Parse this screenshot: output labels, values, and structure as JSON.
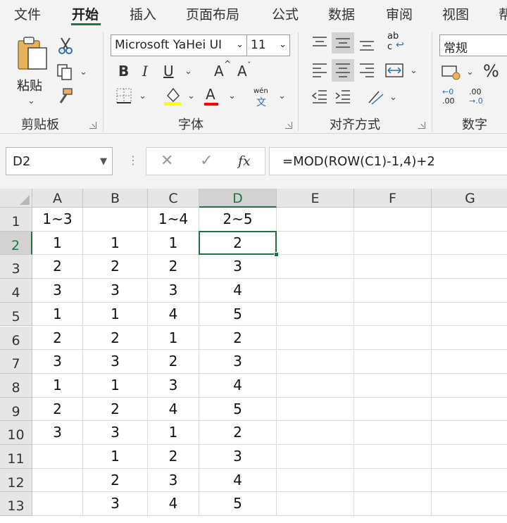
{
  "tabs": [
    "文件",
    "开始",
    "插入",
    "页面布局",
    "公式",
    "数据",
    "审阅",
    "视图",
    "帮"
  ],
  "active_tab": "开始",
  "clipboard": {
    "paste_label": "粘贴",
    "group_label": "剪贴板"
  },
  "font": {
    "name": "Microsoft YaHei UI",
    "size": "11",
    "bold": "B",
    "italic": "I",
    "underline": "U",
    "grow": "A",
    "shrink": "A",
    "color_letter": "A",
    "phonetic_top": "wén",
    "phonetic_bottom": "文",
    "group_label": "字体"
  },
  "alignment": {
    "wrap_top": "ab",
    "wrap_bottom": "c",
    "group_label": "对齐方式"
  },
  "number": {
    "format": "常规",
    "percent": "%",
    "group_label": "数字",
    "inc_top": "←0",
    "inc_bottom": ".00",
    "dec_top": ".00",
    "dec_bottom": "→.0"
  },
  "formula_bar": {
    "name_box": "D2",
    "fx_label": "fx",
    "formula": "=MOD(ROW(C1)-1,4)+2"
  },
  "grid": {
    "columns": [
      "A",
      "B",
      "C",
      "D",
      "E",
      "F",
      "G"
    ],
    "selected_column": "D",
    "selected_row": "2",
    "rows": [
      {
        "num": "1",
        "cells": [
          "1~3",
          "",
          "1~4",
          "2~5",
          "",
          "",
          ""
        ]
      },
      {
        "num": "2",
        "cells": [
          "1",
          "1",
          "1",
          "2",
          "",
          "",
          ""
        ]
      },
      {
        "num": "3",
        "cells": [
          "2",
          "2",
          "2",
          "3",
          "",
          "",
          ""
        ]
      },
      {
        "num": "4",
        "cells": [
          "3",
          "3",
          "3",
          "4",
          "",
          "",
          ""
        ]
      },
      {
        "num": "5",
        "cells": [
          "1",
          "1",
          "4",
          "5",
          "",
          "",
          ""
        ]
      },
      {
        "num": "6",
        "cells": [
          "2",
          "2",
          "1",
          "2",
          "",
          "",
          ""
        ]
      },
      {
        "num": "7",
        "cells": [
          "3",
          "3",
          "2",
          "3",
          "",
          "",
          ""
        ]
      },
      {
        "num": "8",
        "cells": [
          "1",
          "1",
          "3",
          "4",
          "",
          "",
          ""
        ]
      },
      {
        "num": "9",
        "cells": [
          "2",
          "2",
          "4",
          "5",
          "",
          "",
          ""
        ]
      },
      {
        "num": "10",
        "cells": [
          "3",
          "3",
          "1",
          "2",
          "",
          "",
          ""
        ]
      },
      {
        "num": "11",
        "cells": [
          "",
          "1",
          "2",
          "3",
          "",
          "",
          ""
        ]
      },
      {
        "num": "12",
        "cells": [
          "",
          "2",
          "3",
          "4",
          "",
          "",
          ""
        ]
      },
      {
        "num": "13",
        "cells": [
          "",
          "3",
          "4",
          "5",
          "",
          "",
          ""
        ]
      }
    ]
  },
  "colors": {
    "accent": "#217346",
    "ribbon_bg": "#f3f3f3",
    "header_bg": "#e6e6e6",
    "font_color_bar": "#ffff00"
  }
}
